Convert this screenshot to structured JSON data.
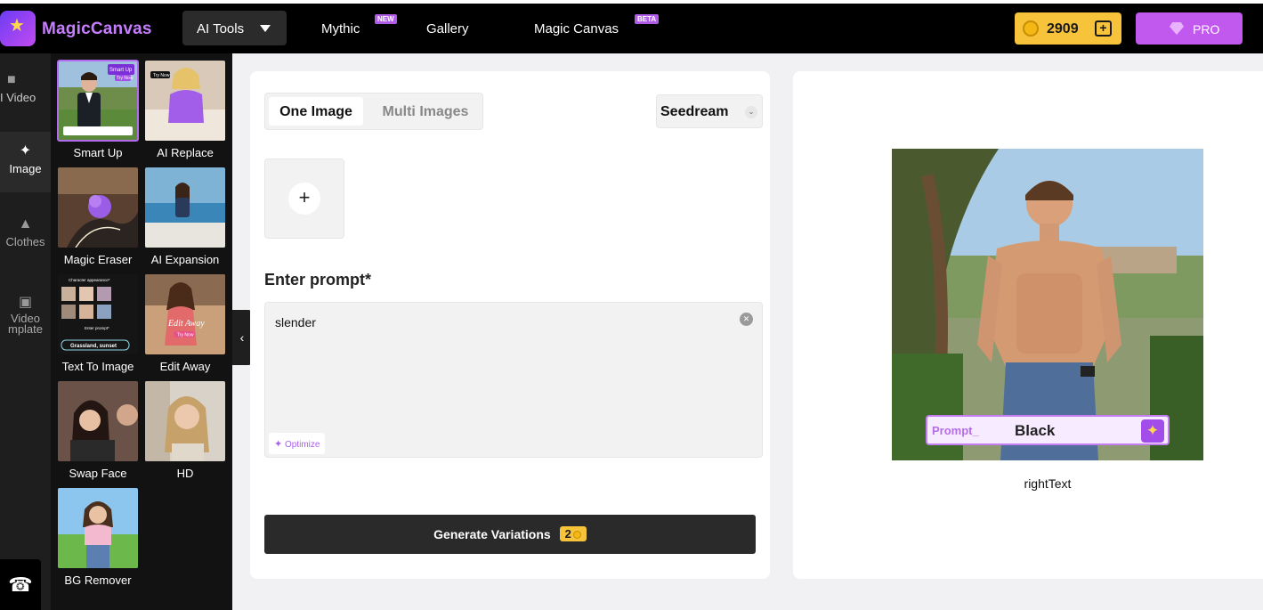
{
  "header": {
    "brand": "MagicCanvas",
    "ai_tools_label": "AI Tools",
    "nav": [
      {
        "label": "Mythic",
        "badge": "NEW"
      },
      {
        "label": "Gallery",
        "badge": ""
      },
      {
        "label": "Magic Canvas",
        "badge": "BETA"
      }
    ],
    "coins": "2909",
    "pro_label": "PRO"
  },
  "rail": {
    "items": [
      {
        "label": "I Video",
        "icon": "video-icon"
      },
      {
        "label": "Image",
        "icon": "sparkle-icon",
        "active": true
      },
      {
        "label": "Clothes",
        "icon": "dress-icon"
      },
      {
        "label": "Video",
        "label2": "mplate",
        "icon": "template-icon"
      }
    ]
  },
  "tools": [
    {
      "label": "Smart Up",
      "selected": true
    },
    {
      "label": "AI Replace"
    },
    {
      "label": "Magic Eraser"
    },
    {
      "label": "AI Expansion"
    },
    {
      "label": "Text To Image"
    },
    {
      "label": "Edit Away"
    },
    {
      "label": "Swap Face"
    },
    {
      "label": "HD"
    },
    {
      "label": "BG Remover"
    }
  ],
  "thumb_text": {
    "smart_up": "Smart Up",
    "smart_up_btn": "Try Now",
    "ai_replace_tag": "Try Now",
    "text_to_image_title": "Character appearance*",
    "text_to_image_prompt": "Enter prompt*",
    "text_to_image_chip": "Grassland, sunset",
    "edit_away_script": "Edit Away",
    "edit_away_btn": "Try Now"
  },
  "editor": {
    "tab_one": "One Image",
    "tab_multi": "Multi Images",
    "model": "Seedream",
    "prompt_title": "Enter prompt*",
    "prompt_value": "slender",
    "optimize_label": "Optimize",
    "generate_label": "Generate Variations",
    "generate_cost": "2"
  },
  "preview": {
    "prompt_label": "Prompt_",
    "prompt_word": "Black",
    "caption": "rightText"
  },
  "colors": {
    "accent_purple": "#c259ef",
    "coin_yellow": "#f6c33a",
    "topbar": "#000000"
  }
}
